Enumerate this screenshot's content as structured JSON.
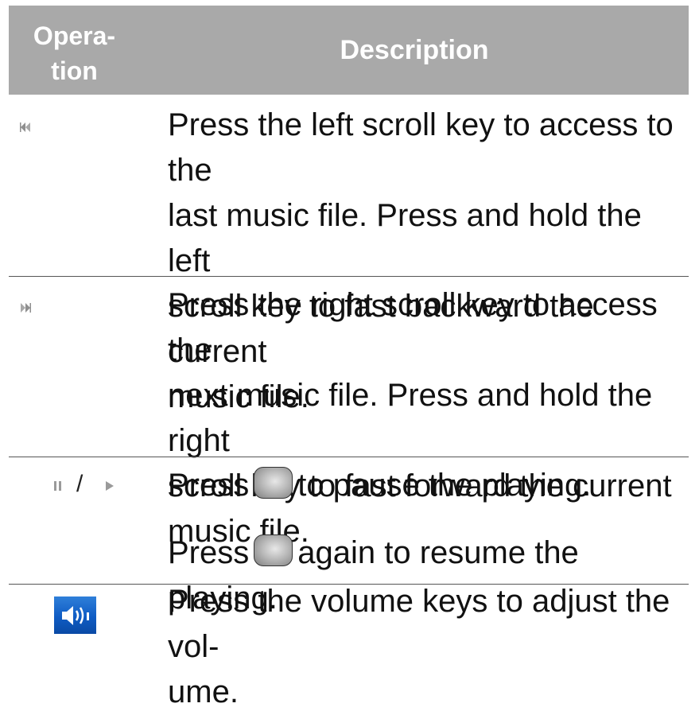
{
  "header": {
    "operation_line1": "Opera-",
    "operation_line2": "tion",
    "description": "Description"
  },
  "rows": [
    {
      "operation_icon": "rewind-icon",
      "lines": [
        "Press the left scroll key to access to the",
        "last music file. Press and hold the left",
        "scroll key to fast backward the current",
        "music file."
      ]
    },
    {
      "operation_icon": "fast-forward-icon",
      "lines": [
        "Press the right scroll key to access the",
        "next music file. Press and hold the right",
        "scroll key to fast forward the current",
        "music file."
      ]
    },
    {
      "operation_icon": "pause-play-icon",
      "operation_separator": "/",
      "line1_pre": "Press",
      "line1_post": "to pause the playing.",
      "line2_pre": "Press",
      "line2_post": "again to resume the playing."
    },
    {
      "operation_icon": "volume-icon",
      "lines": [
        "Press the volume keys to adjust the vol-",
        "ume."
      ]
    }
  ]
}
